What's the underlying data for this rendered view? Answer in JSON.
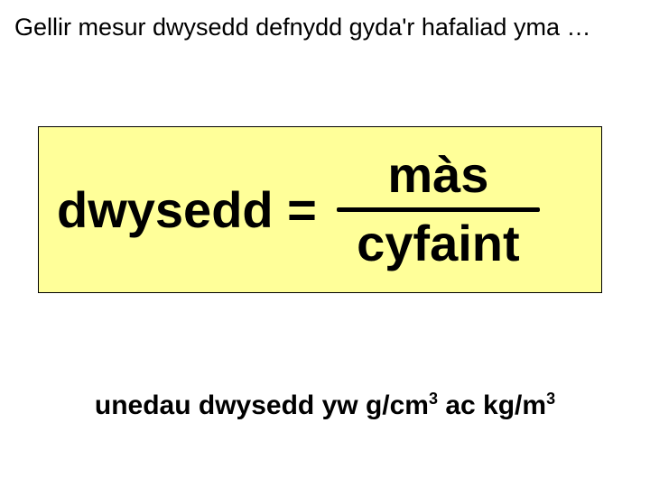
{
  "intro": "Gellir mesur dwysedd defnydd gyda'r hafaliad yma …",
  "formula": {
    "lhs": "dwysedd =",
    "numerator": "màs",
    "denominator": "cyfaint"
  },
  "units": {
    "prefix": "unedau dwysedd yw ",
    "unit1_base": "g/cm",
    "unit1_exp": "3",
    "joiner": " ac ",
    "unit2_base": "kg/m",
    "unit2_exp": "3"
  }
}
